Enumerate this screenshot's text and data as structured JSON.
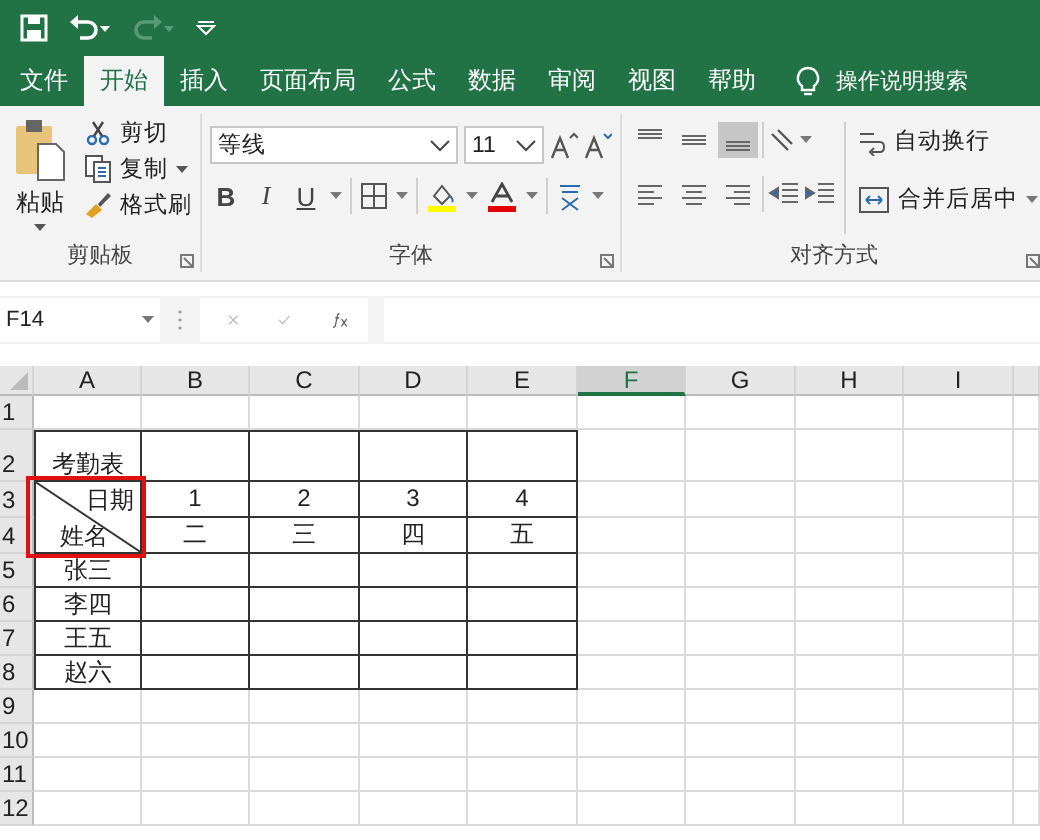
{
  "quick_access": {
    "undo_enabled": true,
    "redo_enabled": false
  },
  "tabs": [
    {
      "label": "文件",
      "selected": false
    },
    {
      "label": "开始",
      "selected": true
    },
    {
      "label": "插入",
      "selected": false
    },
    {
      "label": "页面布局",
      "selected": false
    },
    {
      "label": "公式",
      "selected": false
    },
    {
      "label": "数据",
      "selected": false
    },
    {
      "label": "审阅",
      "selected": false
    },
    {
      "label": "视图",
      "selected": false
    },
    {
      "label": "帮助",
      "selected": false
    }
  ],
  "tell_me": "操作说明搜索",
  "ribbon": {
    "clipboard": {
      "paste": "粘贴",
      "cut": "剪切",
      "copy": "复制",
      "format_painter": "格式刷",
      "label": "剪贴板"
    },
    "font": {
      "font_name": "等线",
      "font_size": "11",
      "bold": "B",
      "italic": "I",
      "underline": "U",
      "label": "字体"
    },
    "alignment": {
      "buttons": [
        {
          "kind": "top",
          "pressed": false
        },
        {
          "kind": "middle",
          "pressed": false
        },
        {
          "kind": "bottom",
          "pressed": true
        }
      ],
      "wrap_text": "自动换行",
      "merge_center": "合并后居中",
      "label": "对齐方式"
    }
  },
  "name_box": "F14",
  "columns": [
    {
      "label": "A",
      "selected": false
    },
    {
      "label": "B",
      "selected": false
    },
    {
      "label": "C",
      "selected": false
    },
    {
      "label": "D",
      "selected": false
    },
    {
      "label": "E",
      "selected": false
    },
    {
      "label": "F",
      "selected": true
    },
    {
      "label": "G",
      "selected": false
    },
    {
      "label": "H",
      "selected": false
    },
    {
      "label": "I",
      "selected": false
    }
  ],
  "rows": [
    {
      "number": "1",
      "bordered": false,
      "cells": {}
    },
    {
      "number": "2",
      "bordered": true,
      "cells": {
        "A": "考勤表"
      }
    },
    {
      "number": "3",
      "bordered": true,
      "cells": {
        "B": "1",
        "C": "2",
        "D": "3",
        "E": "4"
      },
      "diagonal_header": {
        "top_right": "日期",
        "bottom_left": "姓名",
        "highlighted": true
      }
    },
    {
      "number": "4",
      "bordered": true,
      "cells": {
        "B": "二",
        "C": "三",
        "D": "四",
        "E": "五"
      }
    },
    {
      "number": "5",
      "bordered": true,
      "cells": {
        "A": "张三"
      }
    },
    {
      "number": "6",
      "bordered": true,
      "cells": {
        "A": "李四"
      }
    },
    {
      "number": "7",
      "bordered": true,
      "cells": {
        "A": "王五"
      }
    },
    {
      "number": "8",
      "bordered": true,
      "cells": {
        "A": "赵六"
      }
    },
    {
      "number": "9",
      "bordered": false,
      "cells": {}
    },
    {
      "number": "10",
      "bordered": false,
      "cells": {}
    },
    {
      "number": "11",
      "bordered": false,
      "cells": {}
    },
    {
      "number": "12",
      "bordered": false,
      "cells": {}
    }
  ]
}
